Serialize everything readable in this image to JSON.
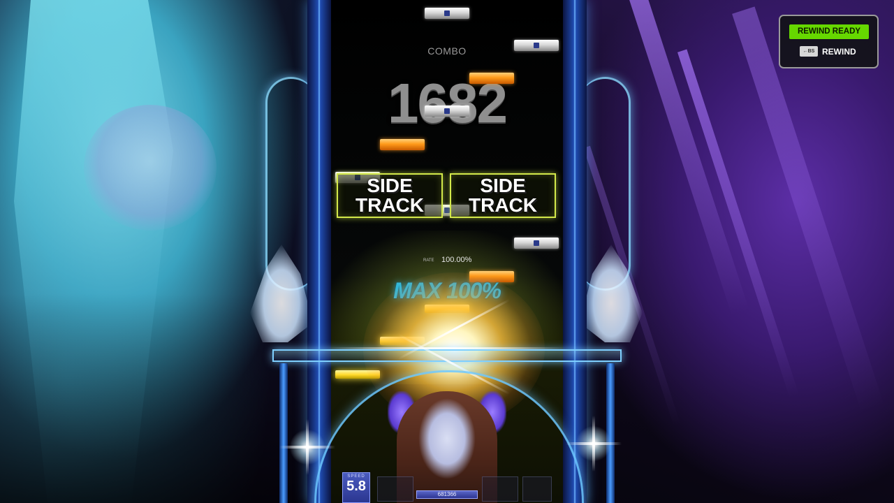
{
  "hud": {
    "combo_label": "COMBO",
    "combo_value": "1682",
    "rate_label": "RATE",
    "rate_value": "100.00%",
    "max_text": "MAX 100%",
    "side_track_left": "SIDE\nTRACK",
    "side_track_right": "SIDE\nTRACK",
    "speed_label": "SPEED",
    "speed_value": "5.8",
    "score_value": "681366"
  },
  "rewind": {
    "status": "REWIND READY",
    "key_label": "←BS",
    "action_label": "REWIND",
    "status_color": "#66d800"
  },
  "icons": {
    "key": "backspace-key-icon",
    "notes": [
      "white-note",
      "orange-note",
      "yellow-note"
    ]
  },
  "colors": {
    "lane_accent": "#d3e84a",
    "frame_accent": "#4a9cff",
    "max_text": "#34b8d8",
    "note_orange": "#ff9a1a"
  }
}
